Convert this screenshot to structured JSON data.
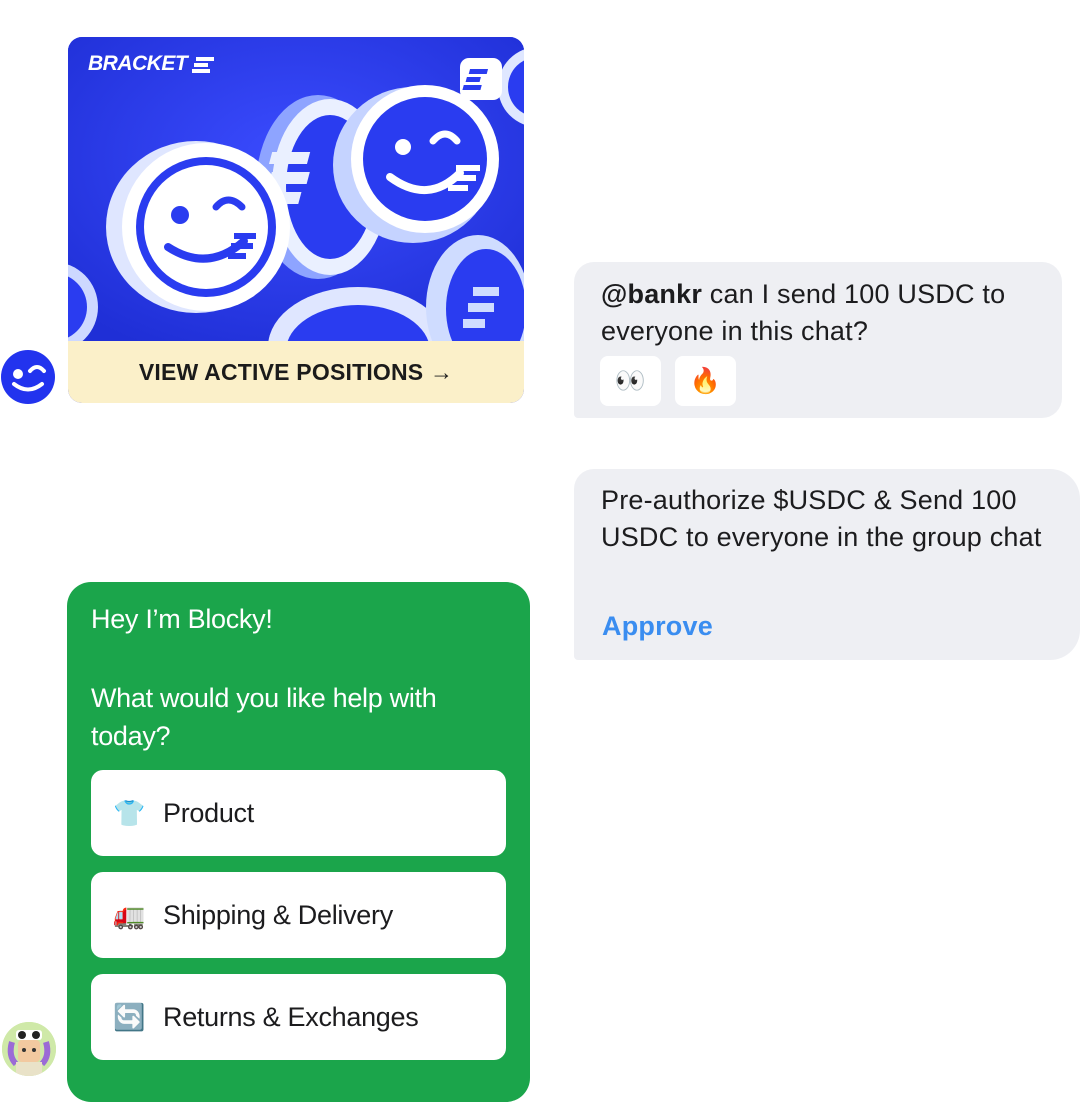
{
  "bracket_card": {
    "logo_text": "BRACKET",
    "cta_label": "VIEW ACTIVE POSITIONS →"
  },
  "messages": [
    {
      "mention": "@bankr",
      "text": " can I send 100 USDC to everyone in this chat?",
      "reactions": [
        "👀",
        "🔥"
      ]
    },
    {
      "text": "Pre-authorize $USDC & Send 100 USDC to everyone in the group chat",
      "action_label": "Approve"
    }
  ],
  "blocky_card": {
    "greeting": "Hey I’m Blocky!",
    "question": "What would you like help with today?",
    "options": [
      {
        "icon": "👕",
        "label": "Product"
      },
      {
        "icon": "🚛",
        "label": "Shipping & Delivery"
      },
      {
        "icon": "🔄",
        "label": "Returns & Exchanges"
      }
    ]
  },
  "colors": {
    "bracket_blue": "#2a3cf0",
    "cta_cream": "#fbf0c9",
    "bubble_gray": "#eeeff3",
    "approve_blue": "#3a8df0",
    "blocky_green": "#1ba54b"
  }
}
